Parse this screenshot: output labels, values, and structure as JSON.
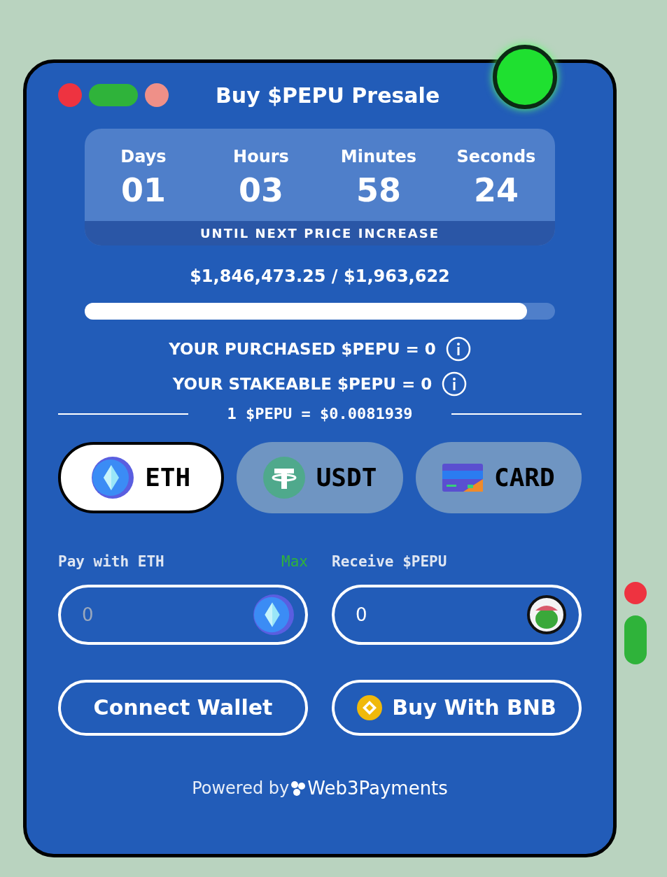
{
  "window": {
    "title": "Buy $PEPU Presale"
  },
  "countdown": {
    "units": [
      {
        "label": "Days",
        "value": "01"
      },
      {
        "label": "Hours",
        "value": "03"
      },
      {
        "label": "Minutes",
        "value": "58"
      },
      {
        "label": "Seconds",
        "value": "24"
      }
    ],
    "caption": "UNTIL NEXT PRICE INCREASE"
  },
  "raised": {
    "text": "$1,846,473.25 / $1,963,622",
    "level": 0.94
  },
  "balances": [
    "YOUR PURCHASED $PEPU = 0",
    "YOUR STAKEABLE $PEPU = 0"
  ],
  "price": "1 $PEPU = $0.0081939",
  "payment_tabs": [
    {
      "label": "ETH",
      "kind": "eth",
      "selected": true
    },
    {
      "label": "USDT",
      "kind": "usdt",
      "selected": false
    },
    {
      "label": "CARD",
      "kind": "card",
      "selected": false
    }
  ],
  "pay": {
    "label": "Pay with ETH",
    "max": "Max",
    "placeholder": "0"
  },
  "receive": {
    "label": "Receive $PEPU",
    "value": "0"
  },
  "buttons": [
    {
      "label": "Connect Wallet",
      "kind": "plain"
    },
    {
      "label": "Buy With BNB",
      "kind": "bnb"
    }
  ],
  "footer": {
    "prefix": "Powered by",
    "brand": "Web3Payments"
  }
}
